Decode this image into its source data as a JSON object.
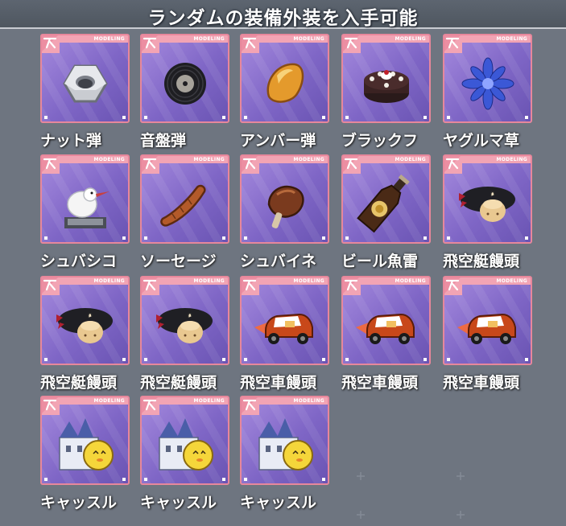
{
  "title": "ランダムの装備外装を入手可能",
  "card_tag": "MODELING",
  "colors": {
    "card_border": "#e7879b",
    "card_header": "#f2a4b4",
    "card_bg": "#8a70cf"
  },
  "items": [
    {
      "label": "ナット弾",
      "icon": "hex-nut-icon"
    },
    {
      "label": "音盤弾",
      "icon": "vinyl-record-icon"
    },
    {
      "label": "アンバー弾",
      "icon": "amber-stone-icon"
    },
    {
      "label": "ブラックフ",
      "icon": "black-cake-icon"
    },
    {
      "label": "ヤグルマ草",
      "icon": "blue-flower-icon"
    },
    {
      "label": "シュバシコ",
      "icon": "bird-statue-icon"
    },
    {
      "label": "ソーセージ",
      "icon": "sausage-icon"
    },
    {
      "label": "シュバイネ",
      "icon": "pork-knuckle-icon"
    },
    {
      "label": "ビール魚雷",
      "icon": "beer-bottle-icon"
    },
    {
      "label": "飛空艇饅頭",
      "icon": "airship-bun-icon"
    },
    {
      "label": "飛空艇饅頭",
      "icon": "airship-bun-icon"
    },
    {
      "label": "飛空艇饅頭",
      "icon": "airship-bun-icon"
    },
    {
      "label": "飛空車饅頭",
      "icon": "car-bun-icon"
    },
    {
      "label": "飛空車饅頭",
      "icon": "car-bun-icon"
    },
    {
      "label": "飛空車饅頭",
      "icon": "car-bun-icon"
    },
    {
      "label": "キャッスル",
      "icon": "castle-chick-icon"
    },
    {
      "label": "キャッスル",
      "icon": "castle-chick-icon"
    },
    {
      "label": "キャッスル",
      "icon": "castle-chick-icon"
    }
  ]
}
